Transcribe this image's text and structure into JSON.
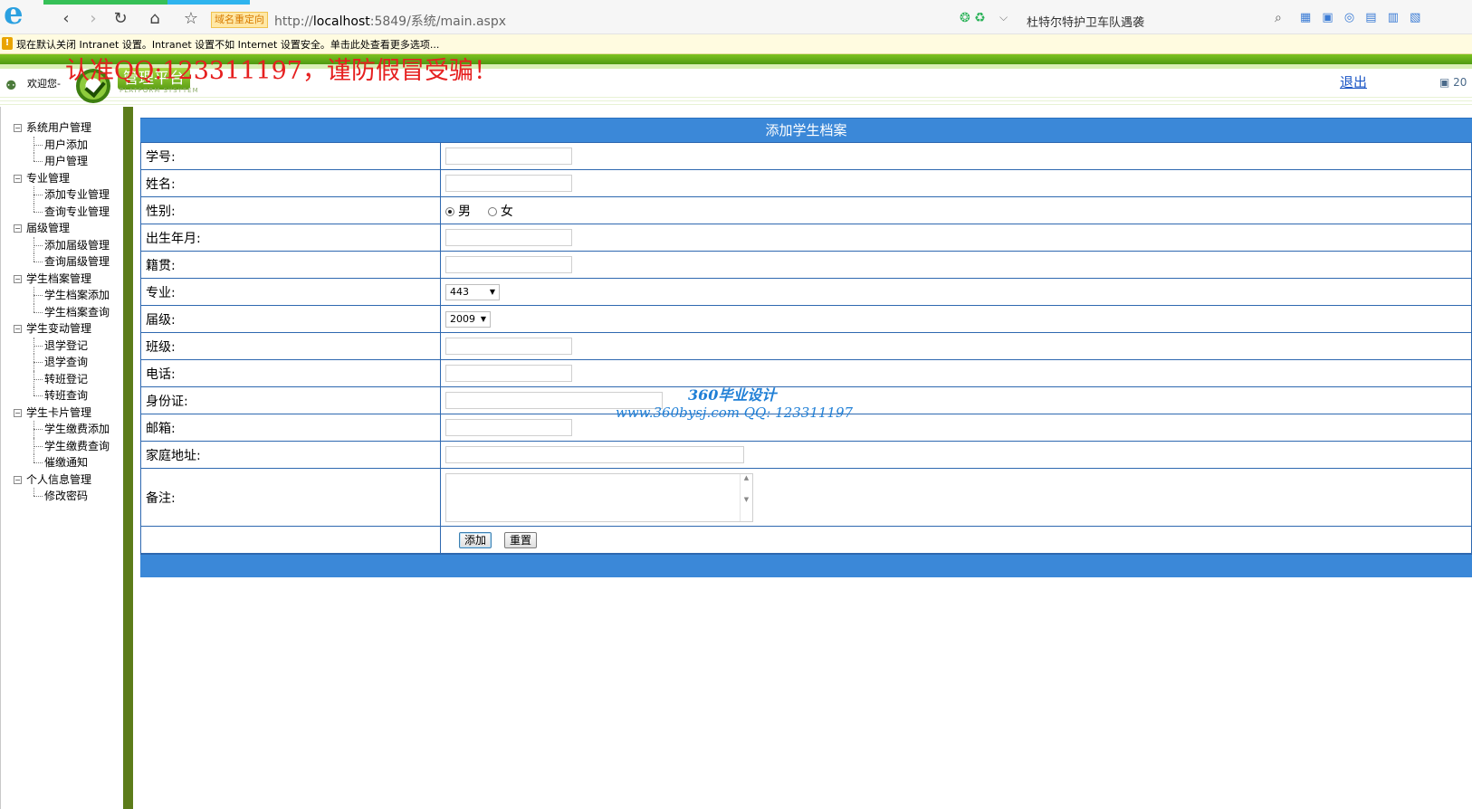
{
  "browser": {
    "logo": "e",
    "back": "‹",
    "forward": "›",
    "refresh": "↻",
    "home": "⌂",
    "favorite": "☆",
    "redirect_badge": "域名重定向",
    "url_prefix": "http://",
    "url_host": "localhost",
    "url_rest": ":5849/系统/main.aspx",
    "news": "杜特尔特护卫车队遇袭",
    "search_icon": "⌕",
    "addr_icons": "❂ ♻",
    "dropdown": "⌵",
    "tools": "▦ ▣ ◎ ▤ ▥ ▧"
  },
  "info_bar": {
    "icon": "!",
    "text": "现在默认关闭 Intranet 设置。Intranet 设置不如 Internet 设置安全。单击此处查看更多选项..."
  },
  "header": {
    "welcome": "欢迎您-",
    "logo_title": "管理平台",
    "logo_subtitle": "PLATFORM SYSYTEM",
    "warning": "认准QQ:123311197，谨防假冒受骗！",
    "logout": "退出",
    "right_text": "20"
  },
  "sidebar": {
    "groups": [
      {
        "label": "系统用户管理",
        "items": [
          "用户添加",
          "用户管理"
        ]
      },
      {
        "label": "专业管理",
        "items": [
          "添加专业管理",
          "查询专业管理"
        ]
      },
      {
        "label": "届级管理",
        "items": [
          "添加届级管理",
          "查询届级管理"
        ]
      },
      {
        "label": "学生档案管理",
        "items": [
          "学生档案添加",
          "学生档案查询"
        ]
      },
      {
        "label": "学生变动管理",
        "items": [
          "退学登记",
          "退学查询",
          "转班登记",
          "转班查询"
        ]
      },
      {
        "label": "学生卡片管理",
        "items": [
          "学生缴费添加",
          "学生缴费查询",
          "催缴通知"
        ]
      },
      {
        "label": "个人信息管理",
        "items": [
          "修改密码"
        ]
      }
    ]
  },
  "form": {
    "title": "添加学生档案",
    "labels": {
      "student_id": "学号:",
      "name": "姓名:",
      "gender": "性别:",
      "birth": "出生年月:",
      "native_place": "籍贯:",
      "major": "专业:",
      "grade": "届级:",
      "class": "班级:",
      "phone": "电话:",
      "id_card": "身份证:",
      "email": "邮箱:",
      "address": "家庭地址:",
      "remark": "备注:"
    },
    "gender_male": "男",
    "gender_female": "女",
    "major_value": "443",
    "grade_value": "2009",
    "add_button": "添加",
    "reset_button": "重置"
  },
  "watermark": {
    "line1": "360毕业设计",
    "line2": "www.360bysj.com      QQ:  123311197"
  }
}
